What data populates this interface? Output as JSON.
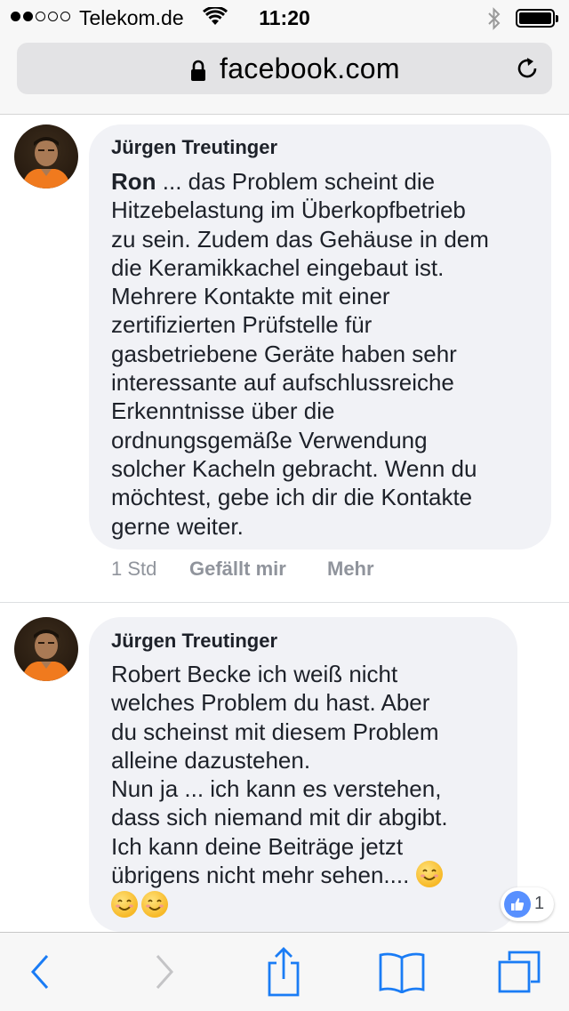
{
  "status_bar": {
    "carrier": "Telekom.de",
    "time": "11:20",
    "signal_bars_filled": 2,
    "signal_bars_total": 5
  },
  "browser": {
    "url": "facebook.com"
  },
  "comments": [
    {
      "author": "Jürgen Treutinger",
      "mention": "Ron",
      "lines": [
        " ... das Problem scheint die",
        "Hitzebelastung im Überkopfbetrieb",
        "zu sein. Zudem das Gehäuse in dem",
        "die Keramikkachel eingebaut ist.",
        "Mehrere Kontakte mit einer",
        "zertifizierten Prüfstelle für",
        "gasbetriebene Geräte haben sehr",
        "interessante auf aufschlussreiche",
        "Erkenntnisse über die",
        "ordnungsgemäße Verwendung",
        "solcher Kacheln gebracht. Wenn du",
        "möchtest, gebe ich dir die Kontakte",
        "gerne weiter."
      ],
      "time": "1 Std",
      "like_label": "Gefällt mir",
      "more_label": "Mehr"
    },
    {
      "author": "Jürgen Treutinger",
      "lines": [
        "Robert Becke ich weiß nicht",
        "welches Problem du hast. Aber",
        "du scheinst mit diesem Problem",
        "alleine dazustehen.",
        "Nun ja ... ich kann es verstehen,",
        "dass sich niemand mit dir abgibt.",
        "Ich kann deine Beiträge jetzt",
        "übrigens nicht mehr sehen...."
      ],
      "reaction_count": "1"
    }
  ],
  "colors": {
    "bubble": "#f1f2f6",
    "ios_blue": "#1a7cf5",
    "like_blue": "#5890ff",
    "meta_gray": "#90949c"
  }
}
